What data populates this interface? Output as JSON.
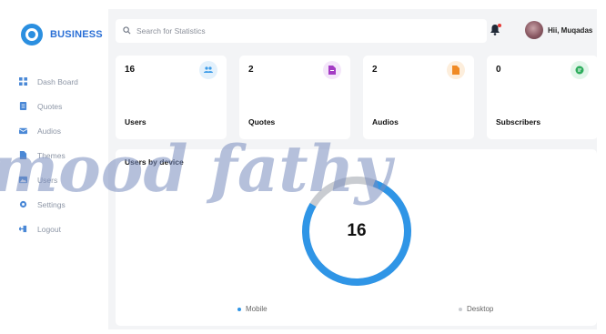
{
  "brand": {
    "name": "BUSINESS",
    "accent": "#2b8fe0"
  },
  "sidebar": {
    "items": [
      {
        "label": "Dash Board",
        "icon": "grid-icon"
      },
      {
        "label": "Quotes",
        "icon": "document-icon"
      },
      {
        "label": "Audios",
        "icon": "envelope-icon"
      },
      {
        "label": "Themes",
        "icon": "file-icon"
      },
      {
        "label": "Users",
        "icon": "image-icon"
      },
      {
        "label": "Settings",
        "icon": "gear-icon"
      },
      {
        "label": "Logout",
        "icon": "logout-icon"
      }
    ]
  },
  "header": {
    "search_placeholder": "Search for Statistics",
    "user_name": "Hii, Muqadas",
    "notification_color": "#e53935"
  },
  "stats": [
    {
      "value": "16",
      "label": "Users",
      "icon": "users-icon",
      "color": "#3b9be8",
      "bg": "#e3f1fc"
    },
    {
      "value": "2",
      "label": "Quotes",
      "icon": "quote-icon",
      "color": "#a43cc4",
      "bg": "#f4e6fa"
    },
    {
      "value": "2",
      "label": "Audios",
      "icon": "audio-icon",
      "color": "#f08a24",
      "bg": "#fdeedc"
    },
    {
      "value": "0",
      "label": "Subscribers",
      "icon": "subscriber-icon",
      "color": "#2fae5e",
      "bg": "#e2f6ea"
    }
  ],
  "device_panel": {
    "title": "Users by device",
    "total": "16",
    "legend": [
      {
        "label": "Mobile",
        "color": "#2f95e6"
      },
      {
        "label": "Desktop",
        "color": "#c9ccd1"
      }
    ]
  },
  "chart_data": {
    "type": "pie",
    "title": "Users by device",
    "categories": [
      "Mobile",
      "Desktop"
    ],
    "values": [
      0.78,
      0.22
    ]
  },
  "watermark": {
    "text": "mood fathy"
  }
}
